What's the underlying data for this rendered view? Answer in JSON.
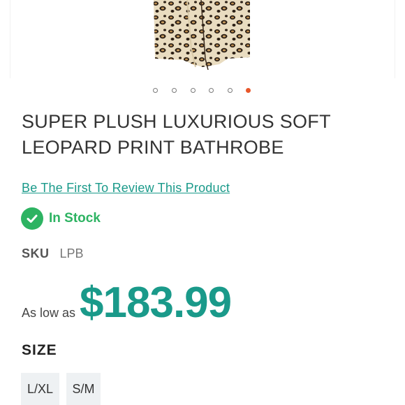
{
  "product": {
    "image_alt": "leopard print bathrobe",
    "carousel": {
      "count": 6,
      "active_index": 5,
      "active_color": "#e8572a"
    },
    "title_line1": "SUPER PLUSH LUXURIOUS SOFT",
    "title_line2": "LEOPARD PRINT BATHROBE",
    "review_link": "Be The First To Review This Product",
    "stock": {
      "icon": "checkmark-circle-icon",
      "label": "In Stock",
      "color": "#2db362"
    },
    "sku": {
      "label": "SKU",
      "value": "LPB"
    },
    "price": {
      "prefix": "As low as",
      "value": "$183.99",
      "color": "#1a9a8a"
    },
    "size": {
      "label": "SIZE",
      "options": [
        "L/XL",
        "S/M"
      ]
    }
  }
}
